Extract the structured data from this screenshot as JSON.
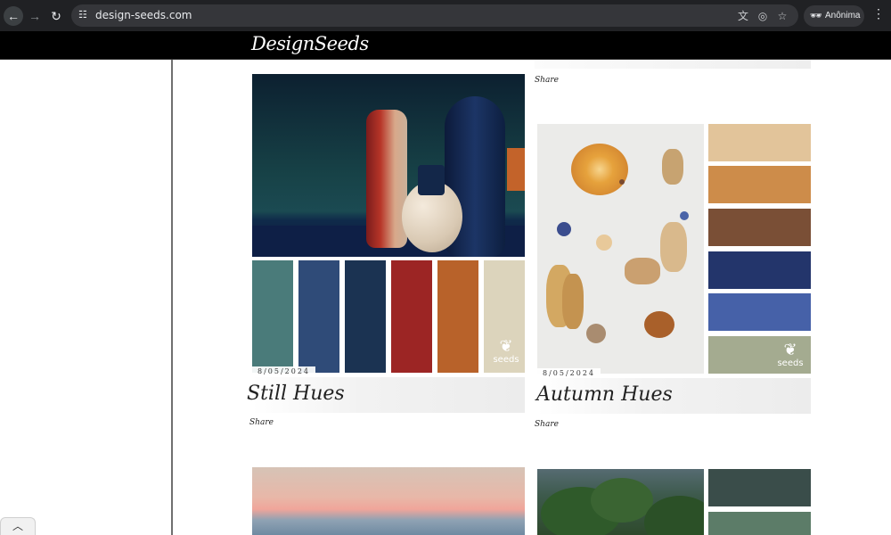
{
  "browser": {
    "url": "design-seeds.com",
    "profile_label": "Anônima",
    "icons": [
      "back-icon",
      "forward-icon",
      "reload-icon",
      "site-info-icon",
      "translate-icon",
      "eye-off-icon",
      "star-icon",
      "incognito-icon",
      "menu-icon"
    ]
  },
  "site": {
    "logo": "DesignSeeds"
  },
  "top_card": {
    "share": "Share"
  },
  "cards": [
    {
      "title": "Still Hues",
      "date": "8/05/2024",
      "share": "Share",
      "swatches": [
        "#4a7b7a",
        "#2f4b78",
        "#1b3352",
        "#9c2524",
        "#b8622a",
        "#dcd4bc"
      ],
      "seeds_label": "seeds"
    },
    {
      "title": "Autumn Hues",
      "date": "8/05/2024",
      "share": "Share",
      "swatches": [
        "#e2c49a",
        "#cd8c4a",
        "#7a4f36",
        "#23356b",
        "#4661a8",
        "#a4ab90"
      ],
      "seeds_label": "seeds"
    }
  ],
  "preview_swatches": [
    "#3a4d4a",
    "#5c7c68"
  ]
}
